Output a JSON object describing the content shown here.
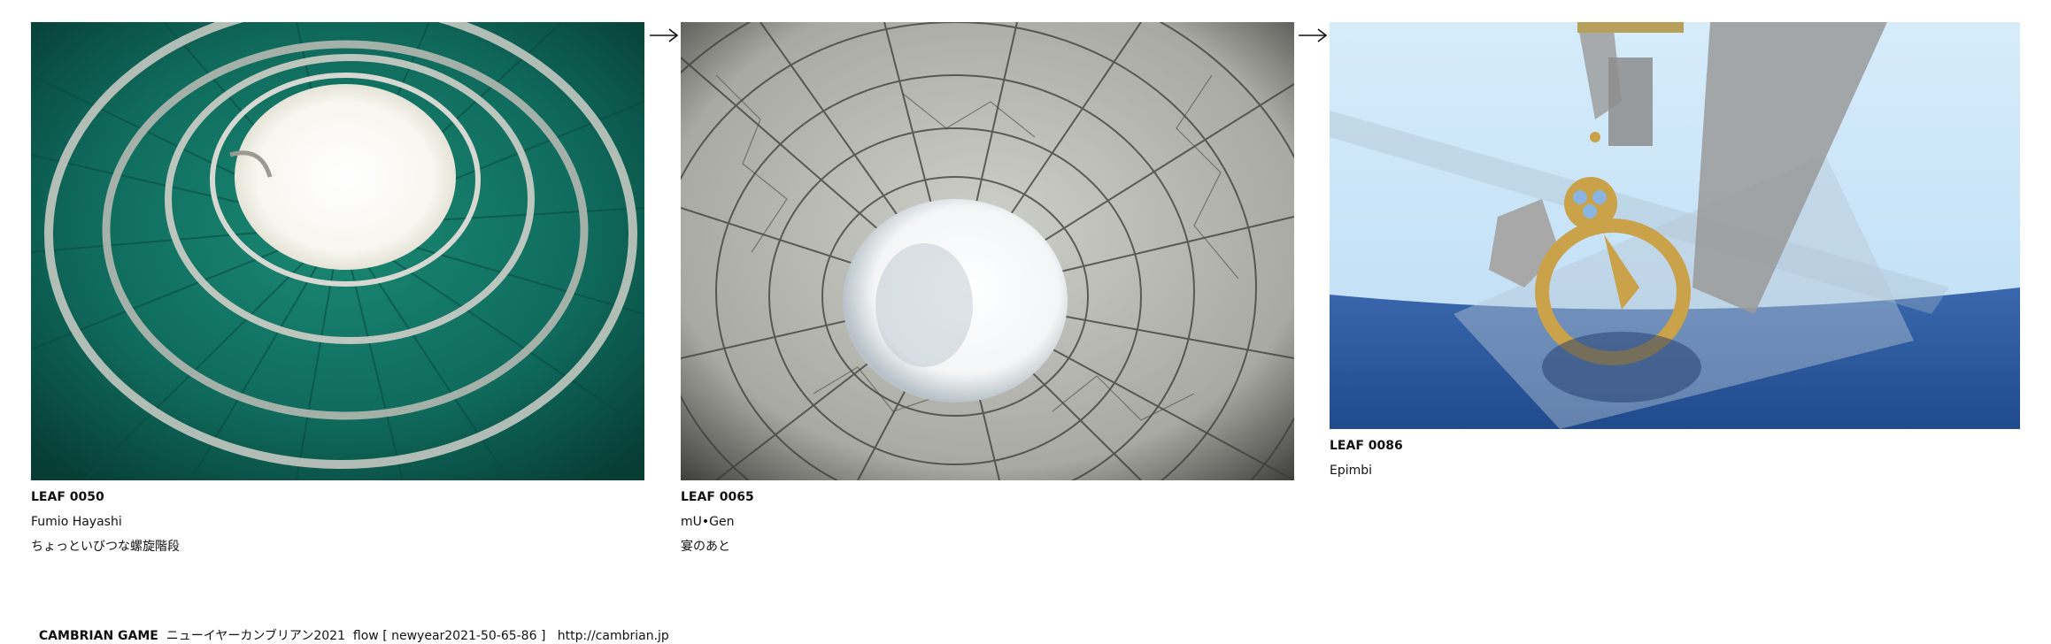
{
  "leaves": [
    {
      "id_label": "LEAF 0050",
      "author": "Fumio Hayashi",
      "title": "ちょっといびつな螺旋階段",
      "image_subject": "spiral-staircase-photo"
    },
    {
      "id_label": "LEAF 0065",
      "author": "mU•Gen",
      "title": "宴のあと",
      "image_subject": "crackled-glaze-bowl-photo"
    },
    {
      "id_label": "LEAF 0086",
      "author": "Epimbi",
      "title": "",
      "image_subject": "3d-render-sundial-scene"
    }
  ],
  "arrows": [
    "right-arrow-icon",
    "right-arrow-icon"
  ],
  "footer": {
    "brand": "CAMBRIAN GAME",
    "event": "ニューイヤーカンブリアン2021",
    "flow": "flow [ newyear2021-50-65-86 ]",
    "url": "http://cambrian.jp"
  },
  "colors": {
    "stair_green": "#0f6a5c",
    "sky_blue": "#c9e6fa",
    "sea_blue": "#2f5aa0",
    "ring_gold": "#c9a24a"
  }
}
